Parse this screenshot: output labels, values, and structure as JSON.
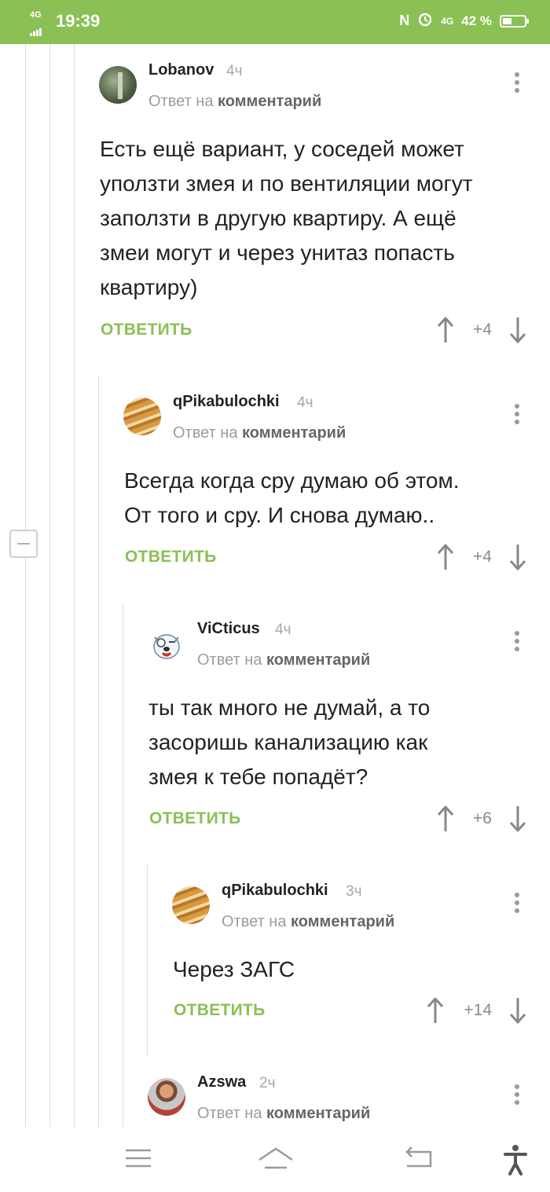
{
  "status_bar": {
    "network_label": "4G",
    "time": "19:39",
    "network_label_right": "4G",
    "battery_text": "42 %",
    "battery_level": 0.42
  },
  "comments": [
    {
      "author": "Lobanov",
      "time": "4ч",
      "reply_prefix": "Ответ на",
      "reply_link": "комментарий",
      "lines": [
        "Есть ещё вариант, у соседей может",
        "уползти змея и по вентиляции могут",
        "заползти в другую квартиру. А ещё",
        "змеи могут и через унитаз попасть",
        "квартиру)"
      ],
      "reply_button": "ОТВЕТИТЬ",
      "score": "+4"
    },
    {
      "author": "qPikabulochki",
      "time": "4ч",
      "reply_prefix": "Ответ на",
      "reply_link": "комментарий",
      "lines": [
        "Всегда когда сру думаю об этом.",
        "От того и сру. И снова думаю.."
      ],
      "reply_button": "ОТВЕТИТЬ",
      "score": "+4"
    },
    {
      "author": "ViCticus",
      "time": "4ч",
      "reply_prefix": "Ответ на",
      "reply_link": "комментарий",
      "lines": [
        "ты так много не думай, а то",
        "засоришь канализацию как",
        "змея к тебе попадёт?"
      ],
      "reply_button": "ОТВЕТИТЬ",
      "score": "+6"
    },
    {
      "author": "qPikabulochki",
      "time": "3ч",
      "reply_prefix": "Ответ на",
      "reply_link": "комментарий",
      "lines": [
        "Через ЗАГС"
      ],
      "reply_button": "ОТВЕТИТЬ",
      "score": "+14"
    },
    {
      "author": "Azswa",
      "time": "2ч",
      "reply_prefix": "Ответ на",
      "reply_link": "комментарий",
      "lines": [],
      "reply_button": "",
      "score": ""
    }
  ],
  "icons": {
    "collapse": "minus-box-icon",
    "menu": "vertical-dots-icon",
    "vote_up": "arrow-up-icon",
    "vote_down": "arrow-down-icon",
    "nav": [
      "hamburger-menu-icon",
      "home-icon",
      "back-icon",
      "accessibility-icon"
    ]
  },
  "colors": {
    "accent": "#8ac054",
    "status_bar": "#8ac054",
    "meta_text": "#a6a6a6"
  }
}
